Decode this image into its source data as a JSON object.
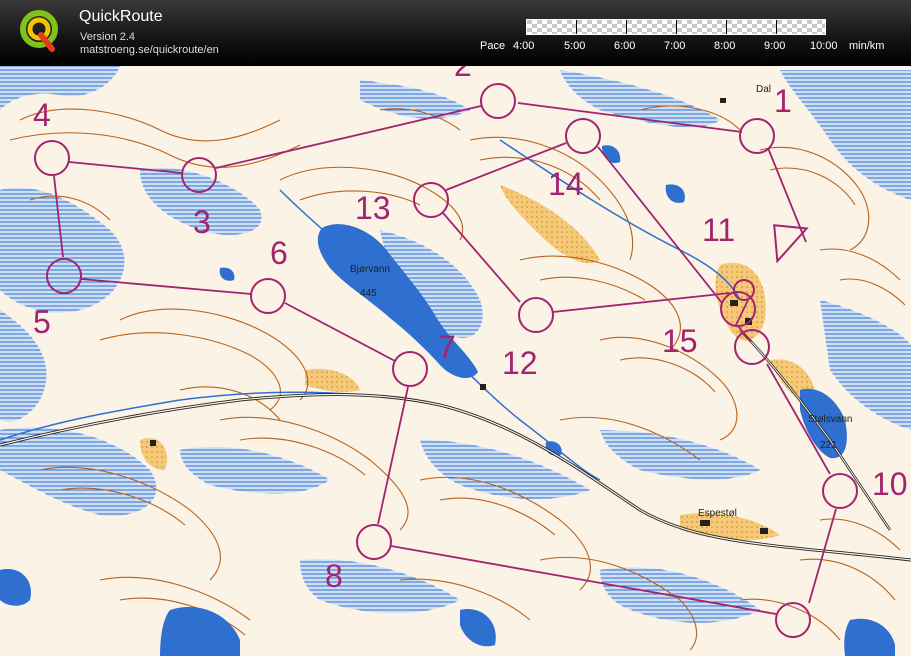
{
  "app": {
    "title": "QuickRoute",
    "version": "Version 2.4",
    "url": "matstroeng.se/quickroute/en"
  },
  "pace": {
    "label": "Pace",
    "ticks": [
      "4:00",
      "5:00",
      "6:00",
      "7:00",
      "8:00",
      "9:00",
      "10:00"
    ],
    "unit": "min/km"
  },
  "map_labels": {
    "lake_name": "Bjørvann",
    "lake_height": "445",
    "place_1": "Dal",
    "place_2": "Espestøl",
    "lake2_name": "Stølsvann",
    "lake2_height": "221"
  },
  "controls": [
    "1",
    "2",
    "3",
    "4",
    "5",
    "6",
    "7",
    "8",
    "10",
    "11",
    "12",
    "13",
    "14",
    "15"
  ],
  "colors": {
    "course": "#a2236e",
    "water": "#2f6fd0",
    "terrain": "#fbf3e6",
    "contour": "#b8621d"
  }
}
